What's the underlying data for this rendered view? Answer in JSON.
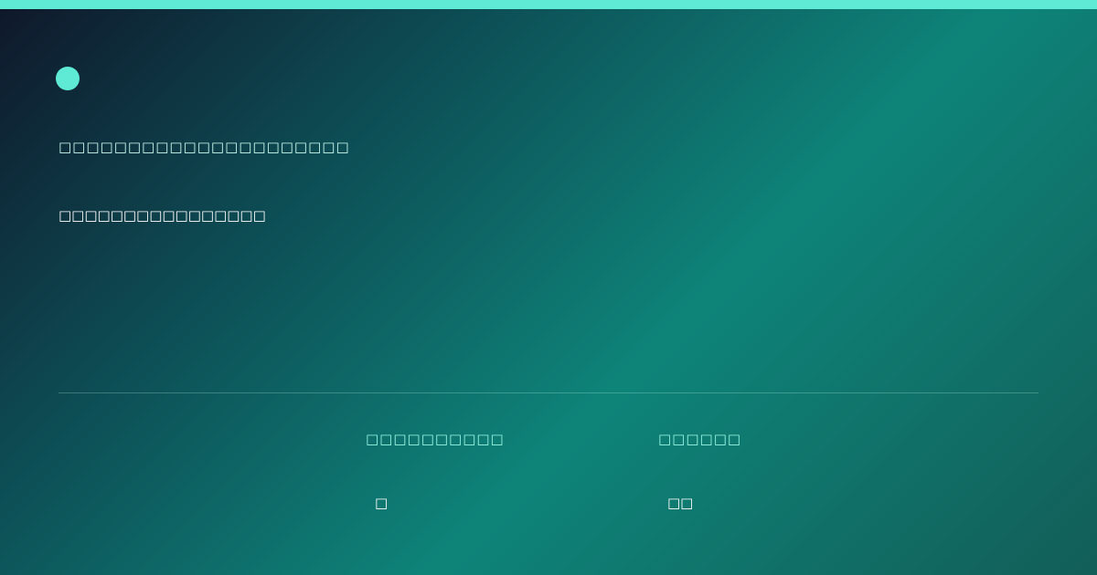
{
  "brand": {
    "accent_color": "#5eead4",
    "background_start": "#0f172a",
    "background_mid": "#0e8479",
    "background_end": "#125e58",
    "logo_icon": "circle-dot"
  },
  "card": {
    "eyebrow": "□□□□□□□□□□□□□□□□□□□□□",
    "headline": "□□□□□□□□□□□□□□□□",
    "stats": [
      {
        "label": "□□□□□□□□□□",
        "value": "□"
      },
      {
        "label": "□□□□□□",
        "value": "□□"
      }
    ]
  }
}
